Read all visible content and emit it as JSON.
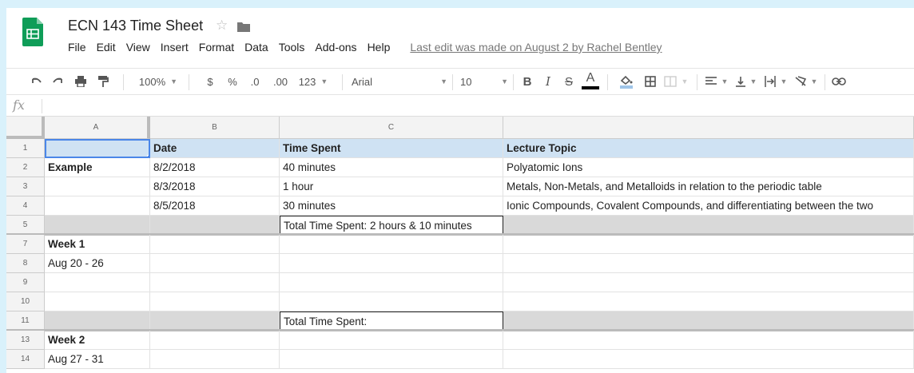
{
  "doc": {
    "title": "ECN 143 Time Sheet",
    "star_icon": "star-icon",
    "folder_icon": "folder-icon"
  },
  "menu": {
    "items": [
      "File",
      "Edit",
      "View",
      "Insert",
      "Format",
      "Data",
      "Tools",
      "Add-ons",
      "Help"
    ],
    "last_edit": "Last edit was made on August 2 by Rachel Bentley"
  },
  "toolbar": {
    "zoom": "100%",
    "currency": "$",
    "percent": "%",
    "decrease_decimal": ".0",
    "increase_decimal": ".00",
    "more_formats": "123",
    "font": "Arial",
    "font_size": "10",
    "bold": "B",
    "italic": "I",
    "strike": "S",
    "text_color": "A"
  },
  "formula": {
    "fx": "fx",
    "value": ""
  },
  "columns": [
    "A",
    "B",
    "C"
  ],
  "rows": [
    {
      "num": "1",
      "a": "",
      "b": "Date",
      "c": "Time Spent",
      "d": "Lecture Topic"
    },
    {
      "num": "2",
      "a": "Example",
      "b": "8/2/2018",
      "c": "40 minutes",
      "d": "Polyatomic Ions"
    },
    {
      "num": "3",
      "a": "",
      "b": "8/3/2018",
      "c": "1 hour",
      "d": "Metals, Non-Metals, and Metalloids in relation to the periodic table"
    },
    {
      "num": "4",
      "a": "",
      "b": "8/5/2018",
      "c": "30 minutes",
      "d": "Ionic Compounds, Covalent Compounds, and differentiating between the two"
    },
    {
      "num": "5",
      "a": "",
      "b": "",
      "c": "Total Time Spent: 2 hours & 10 minutes",
      "d": ""
    },
    {
      "num": "7",
      "a": "Week 1",
      "b": "",
      "c": "",
      "d": ""
    },
    {
      "num": "8",
      "a": "Aug 20 - 26",
      "b": "",
      "c": "",
      "d": ""
    },
    {
      "num": "9",
      "a": "",
      "b": "",
      "c": "",
      "d": ""
    },
    {
      "num": "10",
      "a": "",
      "b": "",
      "c": "",
      "d": ""
    },
    {
      "num": "11",
      "a": "",
      "b": "",
      "c": "Total Time Spent:",
      "d": ""
    },
    {
      "num": "13",
      "a": "Week 2",
      "b": "",
      "c": "",
      "d": ""
    },
    {
      "num": "14",
      "a": "Aug 27 - 31",
      "b": "",
      "c": "",
      "d": ""
    }
  ],
  "colors": {
    "header_fill": "#cfe2f3",
    "total_fill": "#d9d9d9",
    "selection": "#4a86e8",
    "logo": "#0f9d58"
  }
}
